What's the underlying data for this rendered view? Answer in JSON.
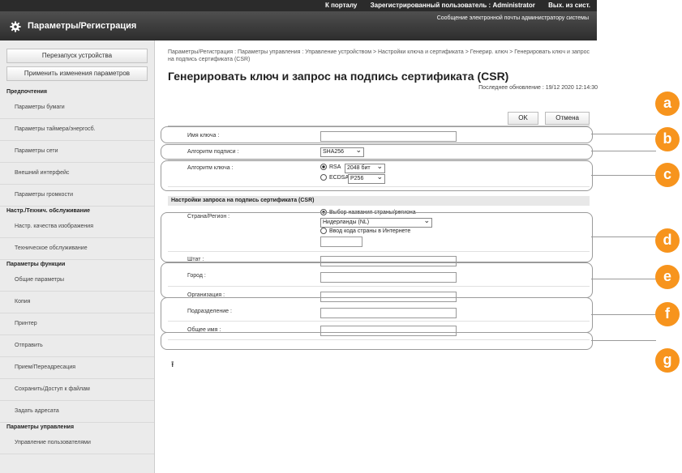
{
  "topbar": {
    "portal": "К порталу",
    "registered_user": "Зарегистрированный пользователь : Administrator",
    "logout": "Вых. из сист."
  },
  "header": {
    "title": "Параметры/Регистрация",
    "mail_link": "Сообщение электронной почты администратору системы",
    "icon": "gear-icon"
  },
  "sidebar": {
    "restart_button": "Перезапуск устройства",
    "apply_button": "Применить изменения параметров",
    "sections": [
      {
        "title": "Предпочтения",
        "items": [
          "Параметры бумаги",
          "Параметры таймера/энергосб.",
          "Параметры сети",
          "Внешний интерфейс",
          "Параметры громкости"
        ]
      },
      {
        "title": "Настр./Технич. обслуживание",
        "items": [
          "Настр. качества изображения",
          "Техническое обслуживание"
        ]
      },
      {
        "title": "Параметры функции",
        "items": [
          "Общие параметры",
          "Копия",
          "Принтер",
          "Отправить",
          "Прием/Переадресация",
          "Сохранить/Доступ к файлам",
          "Задать адресата"
        ]
      },
      {
        "title": "Параметры управления",
        "items": [
          "Управление пользователями"
        ]
      }
    ]
  },
  "main": {
    "breadcrumb": "Параметры/Регистрация : Параметры управления : Управление устройством > Настройки ключа и сертификата > Генерир. ключ > Генерировать ключ и запрос на подпись сертификата (CSR)",
    "title": "Генерировать ключ и запрос на подпись сертификата (CSR)",
    "last_updated": "Последнее обновление : 19/12 2020 12:14:30",
    "ok_button": "OK",
    "cancel_button": "Отмена"
  },
  "form": {
    "key_name_label": "Имя ключа :",
    "key_name_value": "",
    "sig_algo_label": "Алгоритм подписи :",
    "sig_algo_value": "SHA256",
    "key_algo_label": "Алгоритм ключа :",
    "rsa_label": "RSA",
    "rsa_bits": "2048 бит",
    "ecdsa_label": "ECDSA",
    "ecdsa_curve": "P256",
    "csr_section": "Настройки запроса на подпись сертификата (CSR)",
    "country_label": "Страна/Регион :",
    "country_opt1": "Выбор названия страны/региона",
    "country_select": "Нидерланды (NL)",
    "country_opt2": "Ввод кода страны в Интернете",
    "state_label": "Штат :",
    "city_label": "Город :",
    "org_label": "Организация :",
    "unit_label": "Подразделение :",
    "cn_label": "Общее имя :"
  },
  "callouts": [
    "a",
    "b",
    "c",
    "d",
    "e",
    "f",
    "g"
  ],
  "colors": {
    "callout": "#f7941d",
    "header_dark": "#2d2d2d",
    "sidebar_bg": "#ebebeb"
  }
}
